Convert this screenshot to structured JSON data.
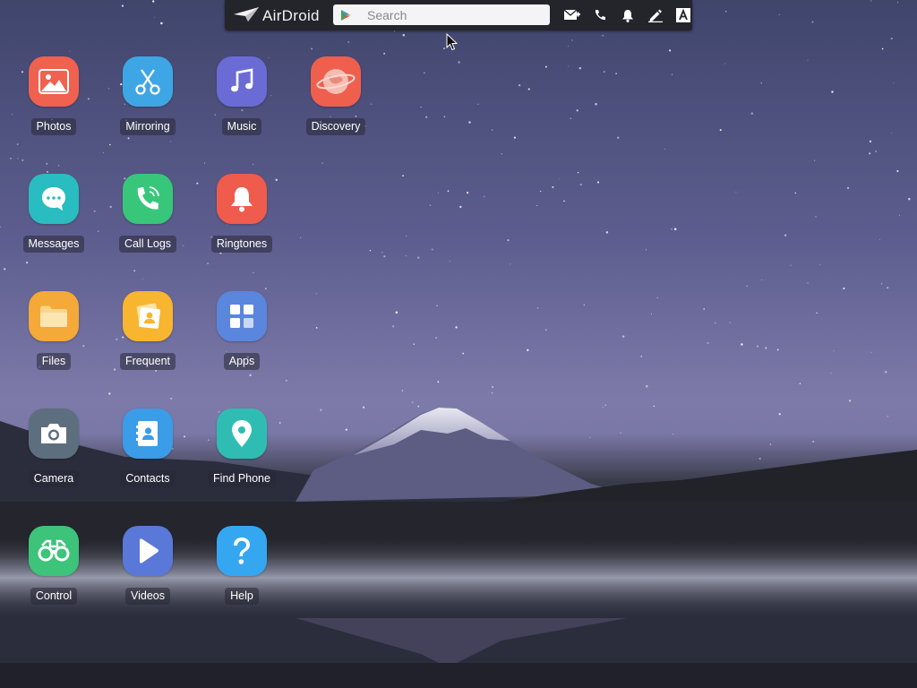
{
  "toolbar": {
    "logo_text": "AirDroid",
    "search_placeholder": "Search",
    "icons": [
      "new-message-icon",
      "phone-icon",
      "bell-icon",
      "pencil-icon",
      "font-a-icon"
    ]
  },
  "apps": [
    {
      "label": "Photos",
      "icon": "photo-icon",
      "color": "#f06150"
    },
    {
      "label": "Mirroring",
      "icon": "scissors-icon",
      "color": "#3fa6e6"
    },
    {
      "label": "Music",
      "icon": "music-note-icon",
      "color": "#6b6bd6"
    },
    {
      "label": "Discovery",
      "icon": "planet-icon",
      "color": "#ef5f4e"
    },
    {
      "label": "Messages",
      "icon": "chat-bubble-icon",
      "color": "#29bcc0"
    },
    {
      "label": "Call Logs",
      "icon": "phone-ringing-icon",
      "color": "#38c67b"
    },
    {
      "label": "Ringtones",
      "icon": "bell-icon",
      "color": "#ef5b4c"
    },
    {
      "label": "Files",
      "icon": "folder-icon",
      "color": "#f4a938"
    },
    {
      "label": "Frequent",
      "icon": "contact-cards-icon",
      "color": "#f8b530"
    },
    {
      "label": "Apps",
      "icon": "grid-icon",
      "color": "#5b86de"
    },
    {
      "label": "Camera",
      "icon": "camera-icon",
      "color": "#5d6f7e"
    },
    {
      "label": "Contacts",
      "icon": "address-book-icon",
      "color": "#3b9ce8"
    },
    {
      "label": "Find Phone",
      "icon": "location-pin-icon",
      "color": "#2fbdb3"
    },
    {
      "label": "Control",
      "icon": "binoculars-icon",
      "color": "#3dc37a"
    },
    {
      "label": "Videos",
      "icon": "play-icon",
      "color": "#5a78d8"
    },
    {
      "label": "Help",
      "icon": "question-mark-icon",
      "color": "#35a7f0"
    }
  ]
}
